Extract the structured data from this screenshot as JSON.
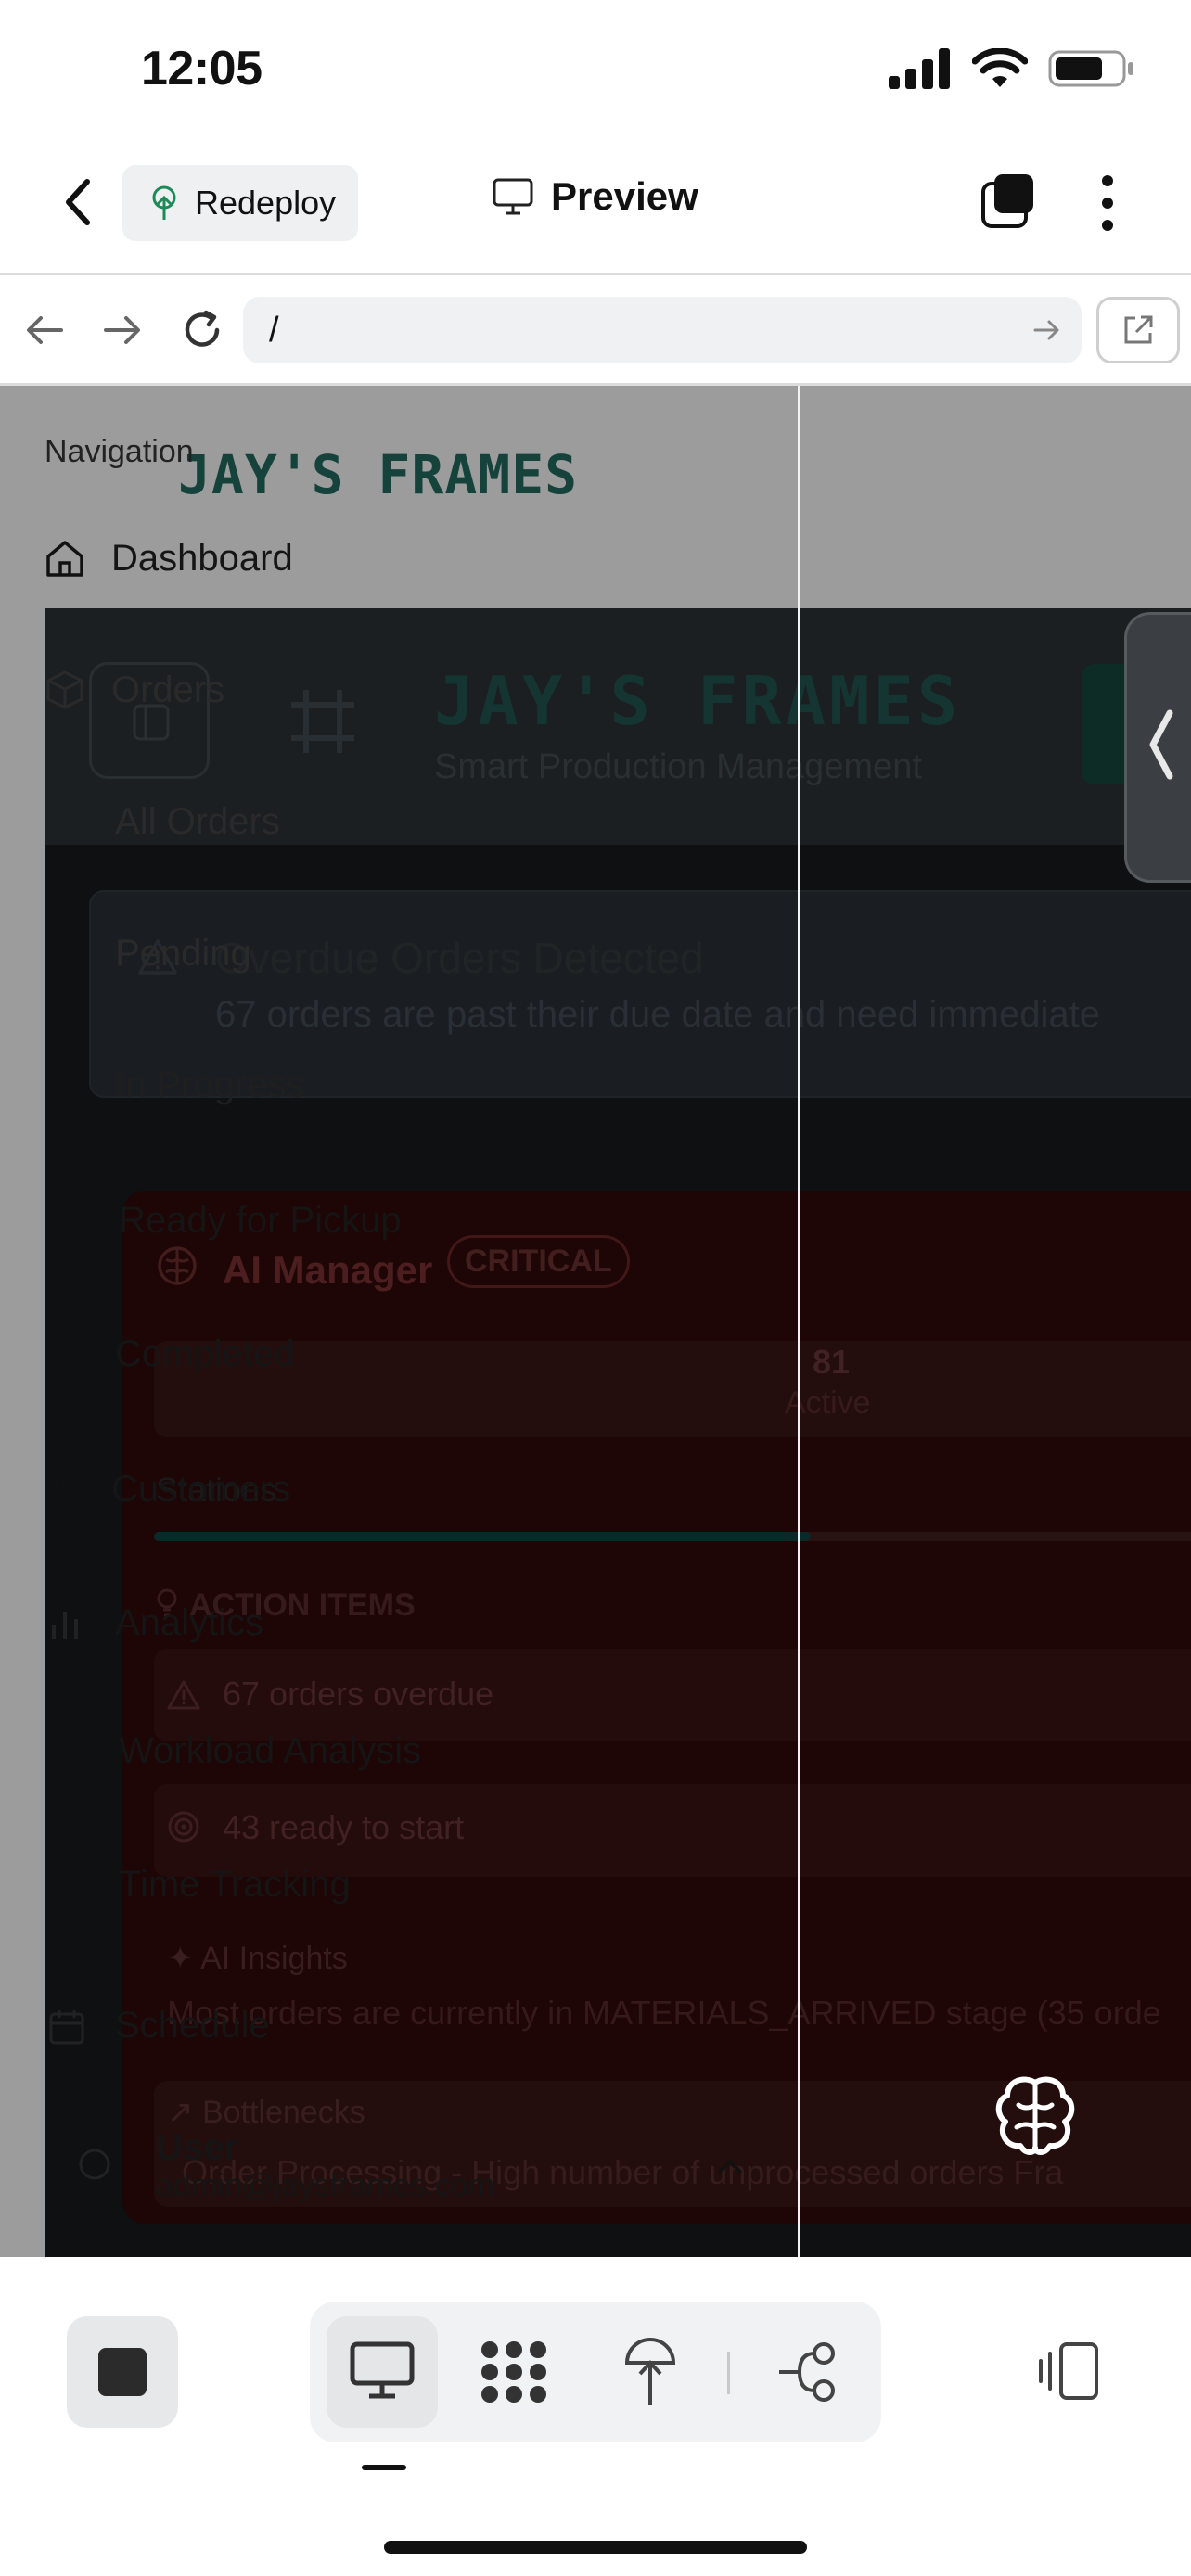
{
  "status_bar": {
    "time": "12:05"
  },
  "header": {
    "redeploy_label": "Redeploy",
    "preview_label": "Preview"
  },
  "browser": {
    "url": "/"
  },
  "app": {
    "brand_behind": "JAY'S FRAMES",
    "brand": "JAY'S FRAMES",
    "brand_subtitle": "Smart Production Management",
    "alert_title": "Overdue Orders Detected",
    "alert_description": "67 orders are past their due date and need immediate",
    "ai_manager": {
      "title": "AI Manager",
      "badge": "CRITICAL",
      "stat_value": "81",
      "stat_label": "Active",
      "progress": 0.6,
      "action_items_title": "ACTION ITEMS",
      "actions": [
        "67 orders overdue",
        "43 ready to start"
      ],
      "insights_title": "AI Insights",
      "insights_text": "Most orders are currently in MATERIALS_ARRIVED stage (35 orde",
      "bottlenecks_title": "Bottlenecks",
      "bottlenecks_text": "Order Processing - High number of unprocessed orders    Fra"
    }
  },
  "sidebar": {
    "heading": "Navigation",
    "items": [
      {
        "label": "Dashboard"
      },
      {
        "label": "Orders"
      },
      {
        "label": "All Orders"
      },
      {
        "label": "Pending"
      },
      {
        "label": "In Progress"
      },
      {
        "label": "Ready for Pickup"
      },
      {
        "label": "Completed"
      },
      {
        "label": "Customers"
      },
      {
        "label": "Analytics"
      },
      {
        "label": "Workload Analysis"
      },
      {
        "label": "Time Tracking"
      },
      {
        "label": "Schedule"
      }
    ],
    "user_name": "User",
    "user_email": "admin@jaysframes.com",
    "ghost_label": "Stations"
  }
}
